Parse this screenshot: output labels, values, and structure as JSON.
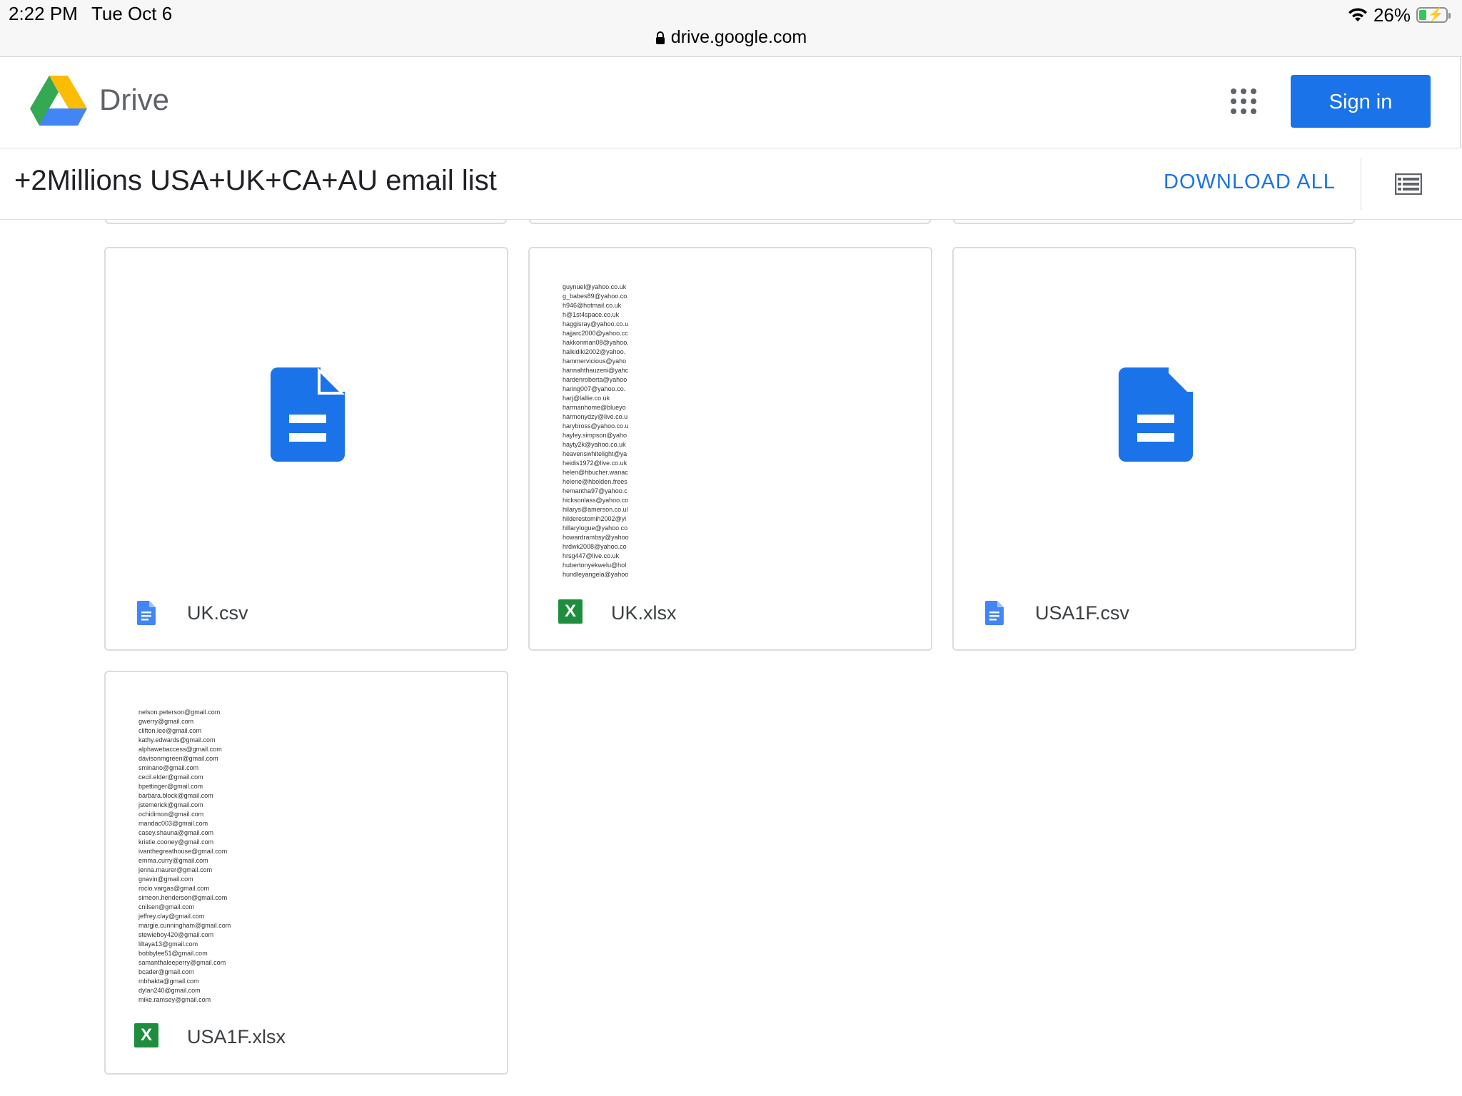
{
  "status_bar": {
    "time": "2:22 PM",
    "date": "Tue Oct 6",
    "battery": "26%",
    "url": "drive.google.com"
  },
  "header": {
    "app_name": "Drive",
    "sign_in_label": "Sign in"
  },
  "folder": {
    "title": "+2Millions USA+UK+CA+AU email list",
    "download_all_label": "DOWNLOAD ALL"
  },
  "files": [
    {
      "name": "UK.csv",
      "type": "csv",
      "icon": "docs-icon"
    },
    {
      "name": "UK.xlsx",
      "type": "xlsx",
      "icon": "sheets-icon",
      "preview_lines": [
        "guynuel@yahoo.co.uk",
        "g_babes89@yahoo.co.",
        "h946@hotmail.co.uk",
        "h@1st4space.co.uk",
        "haggisray@yahoo.co.u",
        "hajjarc2000@yahoo.cc",
        "hakkonman08@yahoo.",
        "halkidiki2002@yahoo.",
        "hammervicious@yaho",
        "hannahthauzeni@yahc",
        "hardenroberta@yahoo",
        "haring007@yahoo.co.",
        "harj@lallie.co.uk",
        "harmanhome@blueyo",
        "harmonydzy@live.co.u",
        "harybross@yahoo.co.u",
        "hayley.simpson@yaho",
        "hayty2k@yahoo.co.uk",
        "heavenswhitelight@ya",
        "heidis1972@live.co.uk",
        "helen@hbucher.wanac",
        "helene@hbolden.frees",
        "hemantha97@yahoo.c",
        "hicksonlass@yahoo.co",
        "hilarys@amerson.co.ul",
        "hilderestomih2002@yi",
        "hillarylogue@yahoo.co",
        "howardrambsy@yahoo",
        "hrdwk2008@yahoo.co",
        "hrsg447@live.co.uk",
        "hubertonyekwelu@hol",
        "hundleyangela@yahoo"
      ]
    },
    {
      "name": "USA1F.csv",
      "type": "csv",
      "icon": "docs-icon"
    },
    {
      "name": "USA1F.xlsx",
      "type": "xlsx",
      "icon": "sheets-icon",
      "preview_lines": [
        "nelson.peterson@gmail.com",
        "gwerry@gmail.com",
        "clifton.lee@gmail.com",
        "kathy.edwards@gmail.com",
        "alphawebaccess@gmail.com",
        "davisonmgreen@gmail.com",
        "sminano@gmail.com",
        "cecil.elder@gmail.com",
        "bpettinger@gmail.com",
        "barbara.block@gmail.com",
        "jstemerick@gmail.com",
        "ochidimon@gmail.com",
        "mandac003@gmail.com",
        "casey.shauna@gmail.com",
        "kristie.cooney@gmail.com",
        "ivanthegreathouse@gmail.com",
        "emma.curry@gmail.com",
        "jenna.maurer@gmail.com",
        "gnavin@gmail.com",
        "rocio.vargas@gmail.com",
        "simeon.henderson@gmail.com",
        "cnilsen@gmail.com",
        "jeffrey.clay@gmail.com",
        "margie.cunningham@gmail.com",
        "stewieboy420@gmail.com",
        "liltaya13@gmail.com",
        "bobbylee51@gmail.com",
        "samanthaleeperry@gmail.com",
        "bcader@gmail.com",
        "mbhakta@gmail.com",
        "dylan240@gmail.com",
        "mike.ramsey@gmail.com"
      ]
    }
  ],
  "colors": {
    "accent": "#1a73e8",
    "docs_blue": "#4285f4",
    "sheets_green": "#1e8e3e"
  }
}
